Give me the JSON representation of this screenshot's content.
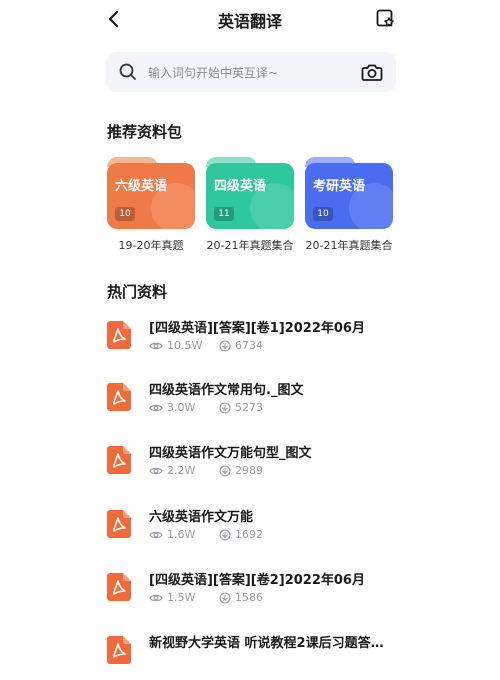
{
  "header": {
    "title": "英语翻译"
  },
  "search": {
    "placeholder": "输入词句开始中英互译~"
  },
  "packs_section": {
    "title": "推荐资料包",
    "packs": [
      {
        "name": "六级英语",
        "count": "10",
        "caption": "19-20年真题",
        "color": "#f07a47"
      },
      {
        "name": "四级英语",
        "count": "11",
        "caption": "20-21年真题集合",
        "color": "#2fc79c"
      },
      {
        "name": "考研英语",
        "count": "10",
        "caption": "20-21年真题集合",
        "color": "#4a6cf0"
      }
    ]
  },
  "hot_section": {
    "title": "热门资料",
    "items": [
      {
        "title": "[四级英语][答案][卷1]2022年06月",
        "views": "10.5W",
        "downloads": "6734"
      },
      {
        "title": "四级英语作文常用句._图文",
        "views": "3.0W",
        "downloads": "5273"
      },
      {
        "title": "四级英语作文万能句型_图文",
        "views": "2.2W",
        "downloads": "2989"
      },
      {
        "title": "六级英语作文万能",
        "views": "1.6W",
        "downloads": "1692"
      },
      {
        "title": "[四级英语][答案][卷2]2022年06月",
        "views": "1.5W",
        "downloads": "1586"
      },
      {
        "title": "新视野大学英语 听说教程2课后习题答…",
        "views": "",
        "downloads": ""
      }
    ]
  },
  "colors": {
    "pdf_red": "#f06a3c"
  },
  "icons": {
    "back": "chevron-left-icon",
    "favorite": "star-bookmark-icon",
    "search": "search-icon",
    "camera": "camera-icon",
    "file": "pdf-file-icon",
    "views": "eye-icon",
    "downloads": "download-icon"
  }
}
